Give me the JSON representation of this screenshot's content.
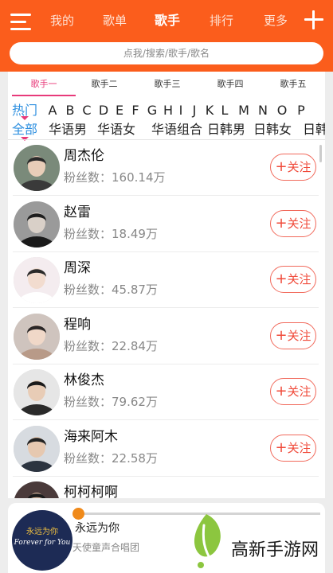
{
  "header": {
    "nav": [
      "我的",
      "歌单",
      "歌手",
      "排行",
      "更多"
    ],
    "active_nav": 2,
    "search_placeholder": "点我/搜索/歌手/歌名"
  },
  "tabs": [
    "歌手一",
    "歌手二",
    "歌手三",
    "歌手四",
    "歌手五"
  ],
  "active_tab": 0,
  "letters": [
    "热门",
    "A",
    "B",
    "C",
    "D",
    "E",
    "F",
    "G",
    "H",
    "I",
    "J",
    "K",
    "L",
    "M",
    "N",
    "O",
    "P"
  ],
  "categories": [
    "全部",
    "华语男",
    "华语女",
    "华语组合",
    "日韩男",
    "日韩女",
    "日韩"
  ],
  "follow_label": "关注",
  "follow_plus": "+",
  "fans_prefix": "粉丝数：",
  "artists": [
    {
      "name": "周杰伦",
      "fans": "160.14万"
    },
    {
      "name": "赵雷",
      "fans": "18.49万"
    },
    {
      "name": "周深",
      "fans": "45.87万"
    },
    {
      "name": "程响",
      "fans": "22.84万"
    },
    {
      "name": "林俊杰",
      "fans": "79.62万"
    },
    {
      "name": "海来阿木",
      "fans": "22.58万"
    },
    {
      "name": "柯柯柯啊",
      "fans": ""
    }
  ],
  "player": {
    "song": "永远为你",
    "artist": "天使童声合唱团",
    "album_title": "永远为你",
    "album_subtitle": "Forever for You",
    "progress": 0.0
  },
  "brand": {
    "text": "高新手游网",
    "leaf_color": "#8cc63f"
  },
  "colors": {
    "header": "#fb5d1c",
    "accent": "#e83a7a",
    "follow": "#f04a3a",
    "letter_active": "#2f90e0"
  }
}
